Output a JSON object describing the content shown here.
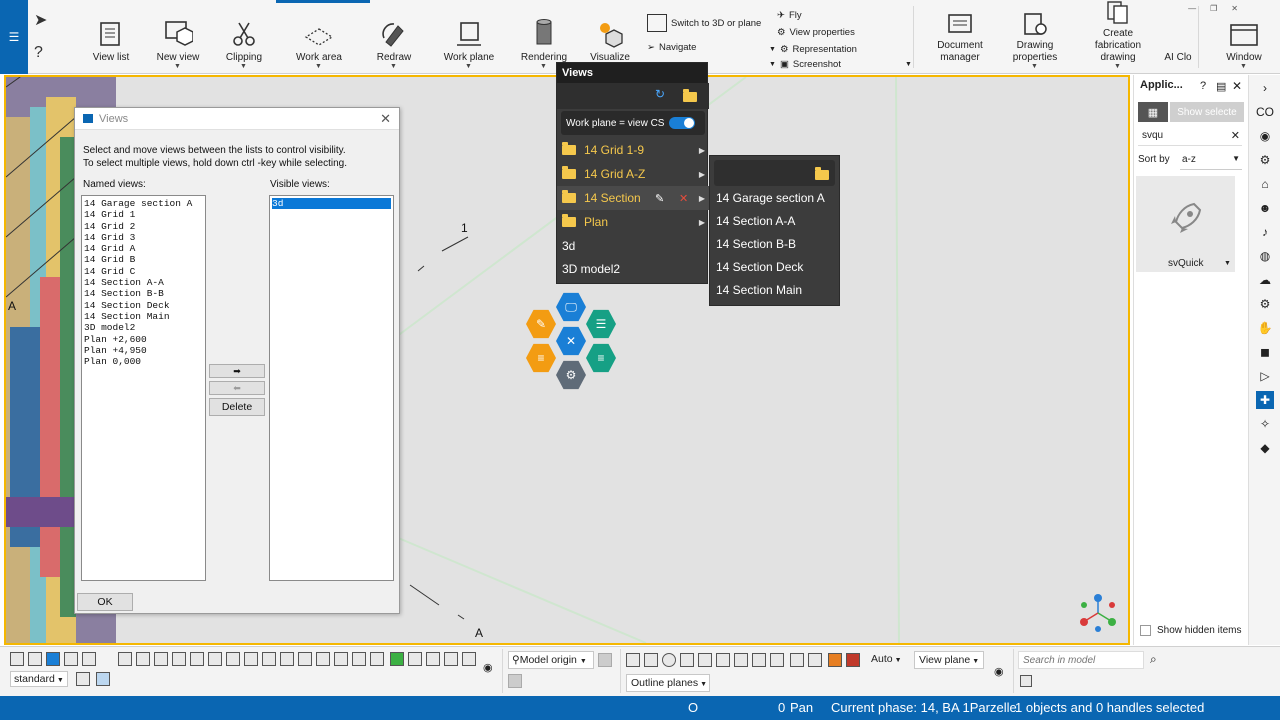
{
  "ribbon": {
    "buttons": [
      {
        "label": "View list"
      },
      {
        "label": "New view"
      },
      {
        "label": "Clipping"
      },
      {
        "label": "Work area"
      },
      {
        "label": "Redraw"
      },
      {
        "label": "Work plane"
      },
      {
        "label": "Rendering"
      },
      {
        "label": "Visualize"
      },
      {
        "label": "Document manager"
      },
      {
        "label": "Drawing properties"
      },
      {
        "label": "Create fabrication drawing"
      },
      {
        "label": "AI Clo"
      },
      {
        "label": "Window"
      }
    ],
    "small_items": [
      "Switch to 3D or plane",
      "Navigate",
      "Fly",
      "View properties",
      "Representation",
      "Screenshot"
    ]
  },
  "views_dialog": {
    "title": "Views",
    "description_line1": "Select and move views between the lists to control visibility.",
    "description_line2": "To select multiple views, hold down ctrl -key while selecting.",
    "named_label": "Named views:",
    "visible_label": "Visible views:",
    "named_views": [
      "14 Garage section A",
      "14 Grid 1",
      "14 Grid 2",
      "14 Grid 3",
      "14 Grid A",
      "14 Grid B",
      "14 Grid C",
      "14 Section A-A",
      "14 Section B-B",
      "14 Section Deck",
      "14 Section Main",
      "3D model2",
      "Plan +2,600",
      "Plan +4,950",
      "Plan 0,000"
    ],
    "visible_views": [
      "3d"
    ],
    "delete_label": "Delete",
    "ok_label": "OK"
  },
  "views_popup": {
    "title": "Views",
    "work_plane_toggle": "Work plane = view CS",
    "folders": [
      "14 Grid 1-9",
      "14 Grid A-Z",
      "14 Section",
      "Plan"
    ],
    "items": [
      "3d",
      "3D model2"
    ],
    "submenu": [
      "14 Garage section A",
      "14 Section A-A",
      "14 Section B-B",
      "14 Section Deck",
      "14 Section Main"
    ]
  },
  "viewport": {
    "grid_label_1": "1",
    "grid_label_a_bottom": "A",
    "grid_label_a_left": "A"
  },
  "right_panel": {
    "title": "Applic...",
    "show_selected": "Show selecte",
    "search_value": "svqu",
    "sort_by_label": "Sort by",
    "sort_value": "a-z",
    "app_name": "svQuick",
    "show_hidden": "Show hidden items"
  },
  "bottom_bar": {
    "standard_select": "standard",
    "model_origin": "Model origin",
    "auto_select": "Auto",
    "view_plane_select": "View plane",
    "outline_planes": "Outline planes",
    "search_placeholder": "Search in model"
  },
  "status": {
    "o": "O",
    "count": "0",
    "mode": "Pan",
    "phase": "Current phase: 14, BA 1Parzelle",
    "selection": "1 objects and 0 handles selected"
  },
  "colors": {
    "accent": "#0a66b2",
    "viewport_border": "#f5b700",
    "folder": "#f5c84c",
    "hex_orange": "#f39c12",
    "hex_teal": "#16a085",
    "hex_blue": "#1a7fd6",
    "hex_gray": "#5f6b78"
  }
}
